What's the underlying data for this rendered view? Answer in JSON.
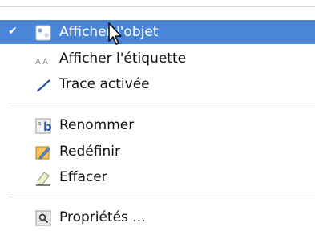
{
  "menu": {
    "items": [
      {
        "label": "Afficher l'objet",
        "icon": "show-object-icon",
        "checked": true,
        "selected": true
      },
      {
        "label": "Afficher l'étiquette",
        "icon": "label-AA-icon",
        "glyph": "AA"
      },
      {
        "label": "Trace activée",
        "icon": "trace-brush-icon"
      },
      {
        "label": "Renommer",
        "icon": "rename-icon",
        "glyph": "b"
      },
      {
        "label": "Redéfinir",
        "icon": "redefine-icon"
      },
      {
        "label": "Effacer",
        "icon": "eraser-icon"
      },
      {
        "label": "Propriétés ...",
        "icon": "properties-icon"
      }
    ]
  },
  "colors": {
    "selection": "#4a86d8",
    "trace_blue": "#1b4fa8",
    "rename_blue": "#2c58a8"
  }
}
